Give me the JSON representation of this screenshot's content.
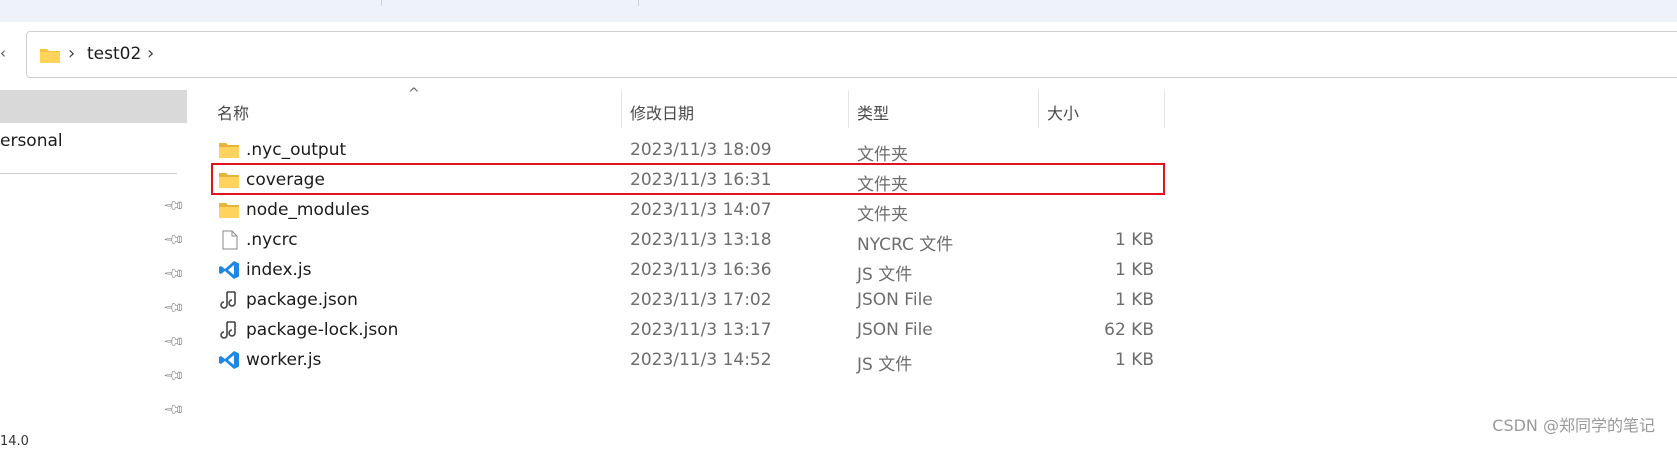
{
  "address": {
    "breadcrumb": [
      "test02"
    ],
    "folder_icon": "folder-icon",
    "chevron_icon": "chevron-right-icon"
  },
  "sidebar": {
    "personal_label": "ersonal",
    "bottom_label": "14.0",
    "pin_icon": "pin-icon"
  },
  "columns": {
    "name": "名称",
    "date": "修改日期",
    "type": "类型",
    "size": "大小"
  },
  "files": [
    {
      "name": ".nyc_output",
      "date": "2023/11/3 18:09",
      "type": "文件夹",
      "size": "",
      "icon": "folder-icon"
    },
    {
      "name": "coverage",
      "date": "2023/11/3 16:31",
      "type": "文件夹",
      "size": "",
      "icon": "folder-icon",
      "highlighted": true
    },
    {
      "name": "node_modules",
      "date": "2023/11/3 14:07",
      "type": "文件夹",
      "size": "",
      "icon": "folder-icon"
    },
    {
      "name": ".nycrc",
      "date": "2023/11/3 13:18",
      "type": "NYCRC 文件",
      "size": "1 KB",
      "icon": "file-icon"
    },
    {
      "name": "index.js",
      "date": "2023/11/3 16:36",
      "type": "JS 文件",
      "size": "1 KB",
      "icon": "vscode-icon"
    },
    {
      "name": "package.json",
      "date": "2023/11/3 17:02",
      "type": "JSON File",
      "size": "1 KB",
      "icon": "json-icon"
    },
    {
      "name": "package-lock.json",
      "date": "2023/11/3 13:17",
      "type": "JSON File",
      "size": "62 KB",
      "icon": "json-icon"
    },
    {
      "name": "worker.js",
      "date": "2023/11/3 14:52",
      "type": "JS 文件",
      "size": "1 KB",
      "icon": "vscode-icon"
    }
  ],
  "watermark": "CSDN @郑同学的笔记",
  "colors": {
    "highlight_border": "#e0141e",
    "folder_yellow": "#f5c342",
    "vscode_blue": "#1e88e5"
  }
}
